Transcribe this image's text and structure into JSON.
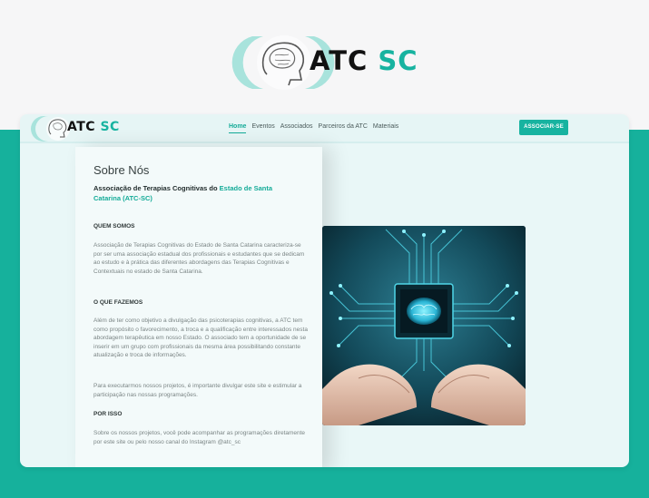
{
  "brand": {
    "part1": "ATC",
    "part2": "SC"
  },
  "nav": {
    "links": [
      "Home",
      "Eventos",
      "Associados",
      "Parceiros da ATC",
      "Materiais"
    ],
    "cta": "ASSOCIAR-SE"
  },
  "about": {
    "title": "Sobre Nós",
    "subtitle_prefix": "Associação de Terapias Cognitivas do ",
    "subtitle_highlight": "Estado de Santa Catarina (ATC-SC)",
    "sections": [
      {
        "heading": "QUEM SOMOS",
        "text": "Associação de Terapias Cognitivas do Estado de Santa Catarina caracteriza-se por ser uma associação estadual dos profissionais e estudantes que se dedicam ao estudo e à prática das diferentes abordagens das Terapias Cognitivas e Contextuais no estado de Santa Catarina."
      },
      {
        "heading": "O QUE FAZEMOS",
        "text": "Além de ter como objetivo a divulgação das psicoterapias cognitivas, a ATC tem como propósito o favorecimento, a troca e a qualificação entre interessados nesta abordagem terapêutica em nosso Estado. O associado tem a oportunidade de se inserir em um grupo com profissionais da mesma área possibilitando constante atualização e troca de informações."
      },
      {
        "heading": "",
        "text": "Para executarmos nossos projetos, é importante divulgar este site e estimular a participação nas nossas programações."
      },
      {
        "heading": "POR ISSO",
        "text": "Sobre os nossos projetos, você pode acompanhar as programações diretamente por este site ou pelo nosso canal do Instagram @atc_sc"
      }
    ]
  },
  "colors": {
    "accent": "#17b3a0",
    "band": "#16b19c",
    "dark": "#111111"
  },
  "hero_image": "hands-holding-glowing-brain-circuit"
}
